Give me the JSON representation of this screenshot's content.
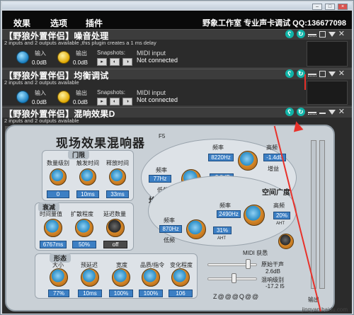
{
  "menubar": {
    "items": [
      "效果",
      "选项",
      "插件"
    ],
    "title": "野象工作室 专业声卡调试 QQ:136677098"
  },
  "plugins": [
    {
      "title": "【野狼外置伴侣】噪音处理",
      "sub": "2 inputs and 2 outputs available ,this plugin creates a 1 ms delay",
      "input_label": "输入",
      "output_label": "输出",
      "input_val": "0.0dB",
      "output_val": "0.0dB",
      "snapshots_label": "Snapshots:",
      "midi_label": "MIDI input",
      "midi_val": "Not connected"
    },
    {
      "title": "【野狼外置伴侣】均衡调试",
      "sub": "2 inputs and 2 outputs available",
      "input_label": "输入",
      "output_label": "输出",
      "input_val": "0.0dB",
      "output_val": "0.0dB",
      "snapshots_label": "Snapshots:",
      "midi_label": "MIDI input",
      "midi_val": "Not connected"
    },
    {
      "title": "【野狼外置伴侣】混响效果D",
      "sub": "2 inputs and 2 outputs available"
    }
  ],
  "reverb": {
    "title": "现场效果混响器",
    "f5": "F5",
    "limit": {
      "label": "门限",
      "controls": [
        {
          "label": "数量级别",
          "value": "0"
        },
        {
          "label": "触发时间",
          "value": "10ms"
        },
        {
          "label": "释放时间",
          "value": "33ms"
        }
      ]
    },
    "decay": {
      "label": "衰减",
      "controls": [
        {
          "label": "时间量值",
          "value": "6767ms"
        },
        {
          "label": "扩散程度",
          "value": "50%"
        },
        {
          "label": "延迟数量",
          "value": "off"
        }
      ]
    },
    "shape": {
      "label": "形态",
      "controls": [
        {
          "label": "大小",
          "value": "77%"
        },
        {
          "label": "预延迟",
          "value": "10ms"
        },
        {
          "label": "宽度",
          "value": "100%"
        },
        {
          "label": "品质/指令",
          "value": "100%"
        },
        {
          "label": "变化程度",
          "value": "106"
        }
      ]
    },
    "eq": {
      "label": "均衡",
      "freq_label": "频率",
      "low_label": "低频",
      "high_label": "高频",
      "gain_label": "增益",
      "low_freq": "77Hz",
      "mid_freq": "8220Hz",
      "gain_low": "-3.8dB",
      "high_gain": "-1.4dB"
    },
    "space": {
      "label": "空间广度",
      "freq_label": "频率",
      "low_label": "低频",
      "high_label": "高频",
      "amt_label": "AHT",
      "low_freq": "870Hz",
      "freq": "2490Hz",
      "mid_pct": "31%",
      "high_pct": "20%"
    },
    "midi_label": "MIDI 获悉",
    "dry_label": "原始干声",
    "dry_val": "2.6dB",
    "wet_label": "混响级别",
    "wet_val": "-17.2 l5",
    "out_label": "输出",
    "logo": "Z@@@Q@@",
    "watermark": "jingyan.baidu.com"
  }
}
